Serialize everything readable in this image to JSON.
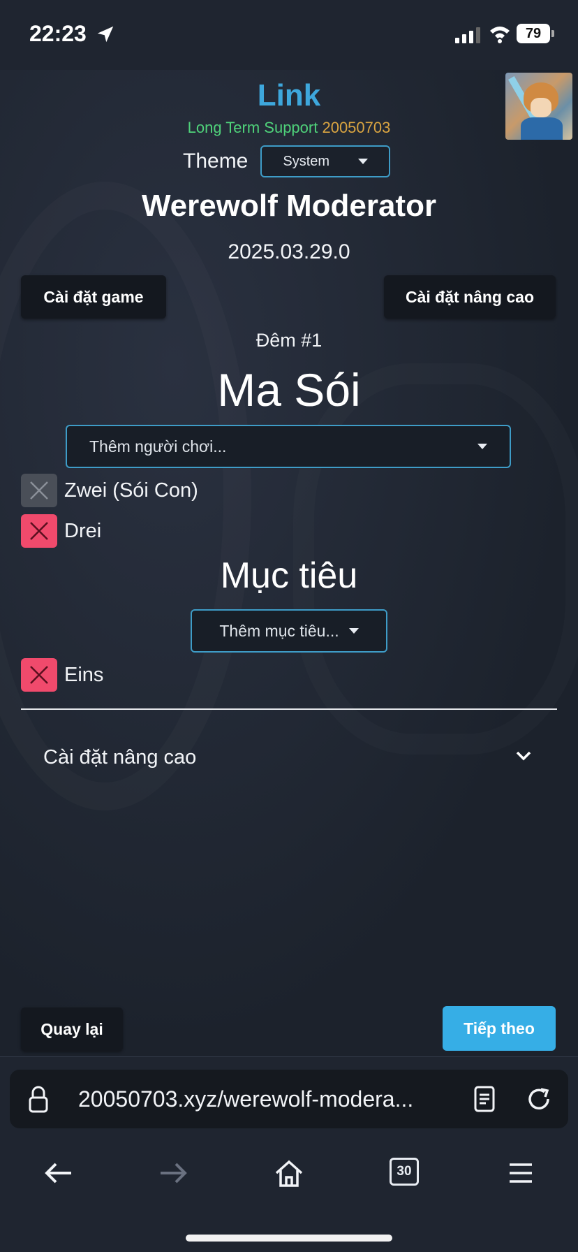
{
  "status": {
    "time": "22:23",
    "battery": "79"
  },
  "header": {
    "app_title": "Link",
    "lts_label": "Long Term Support",
    "lts_number": "20050703",
    "theme_label": "Theme",
    "theme_value": "System",
    "game_title": "Werewolf Moderator",
    "version": "2025.03.29.0"
  },
  "buttons": {
    "game_settings": "Cài đặt game",
    "advanced_settings": "Cài đặt nâng cao",
    "back": "Quay lại",
    "next": "Tiếp theo"
  },
  "night": {
    "label": "Đêm #1",
    "role": "Ma Sói",
    "add_player_placeholder": "Thêm người chơi...",
    "players": [
      {
        "name": "Zwei (Sói Con)",
        "state": "disabled"
      },
      {
        "name": "Drei",
        "state": "active"
      }
    ],
    "target_title": "Mục tiêu",
    "add_target_placeholder": "Thêm mục tiêu...",
    "targets": [
      {
        "name": "Eins",
        "state": "active"
      }
    ],
    "advanced_section": "Cài đặt nâng cao"
  },
  "browser": {
    "url": "20050703.xyz/werewolf-modera...",
    "tab_count": "30"
  },
  "colors": {
    "accent": "#3ea7dc",
    "lts_green": "#4fd27a",
    "lts_number": "#d9a441",
    "remove_active": "#f04a6c",
    "next_button": "#36aee6"
  }
}
